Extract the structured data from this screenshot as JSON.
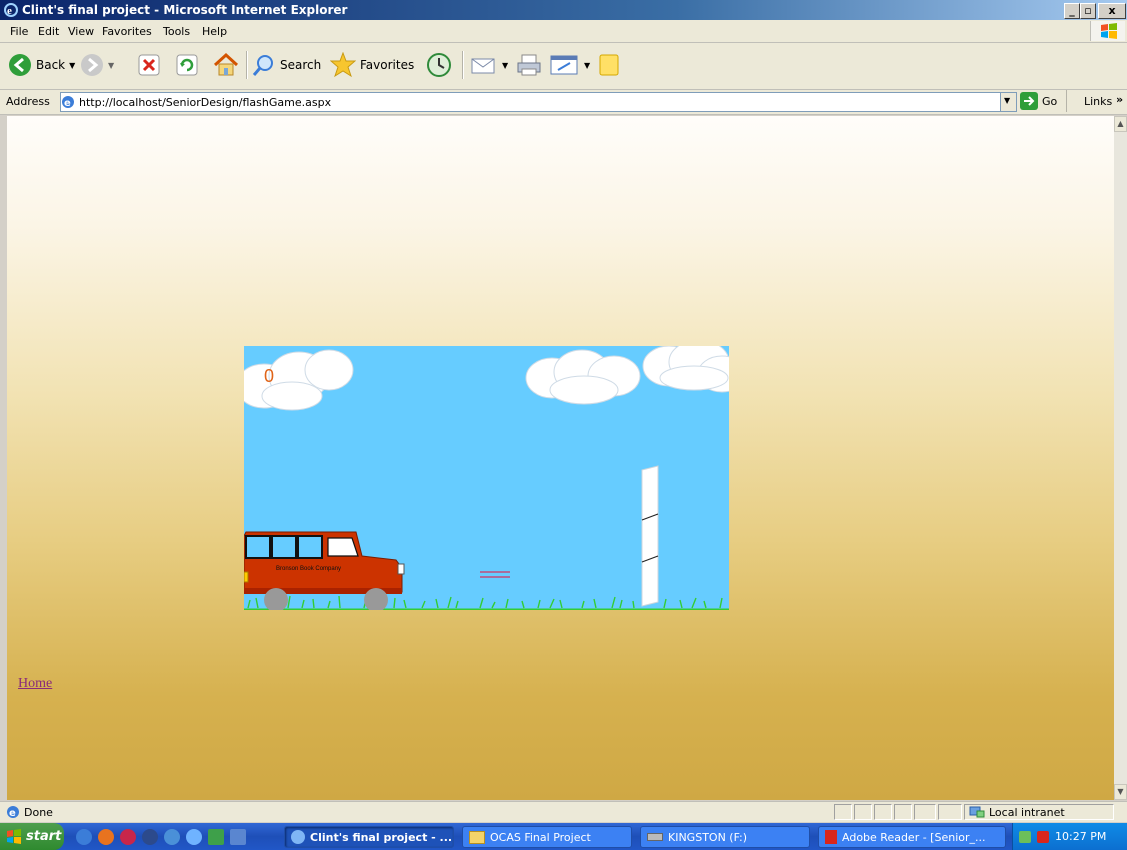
{
  "window": {
    "title": "Clint's final project - Microsoft Internet Explorer",
    "controls": {
      "minimize": "_",
      "maximize": "▫",
      "close": "x"
    }
  },
  "menu": [
    "File",
    "Edit",
    "View",
    "Favorites",
    "Tools",
    "Help"
  ],
  "toolbar": {
    "back_label": "Back",
    "search_label": "Search",
    "favorites_label": "Favorites"
  },
  "address": {
    "label": "Address",
    "url": "http://localhost/SeniorDesign/flashGame.aspx",
    "go_label": "Go",
    "links_label": "Links",
    "links_chevron": "»"
  },
  "page": {
    "home_link": "Home"
  },
  "game": {
    "score": "0",
    "truck_text": "Bronson Book Company",
    "colors": {
      "sky": "#66ccff",
      "truck": "#cc3300",
      "score": "#e06418",
      "grass": "#33cc33"
    }
  },
  "status": {
    "text": "Done",
    "zone": "Local intranet"
  },
  "taskbar": {
    "start_label": "start",
    "tasks": [
      "Clint's final project - ...",
      "OCAS Final Project",
      "KINGSTON (F:)",
      "Adobe Reader - [Senior_..."
    ],
    "clock": "10:27 PM"
  }
}
